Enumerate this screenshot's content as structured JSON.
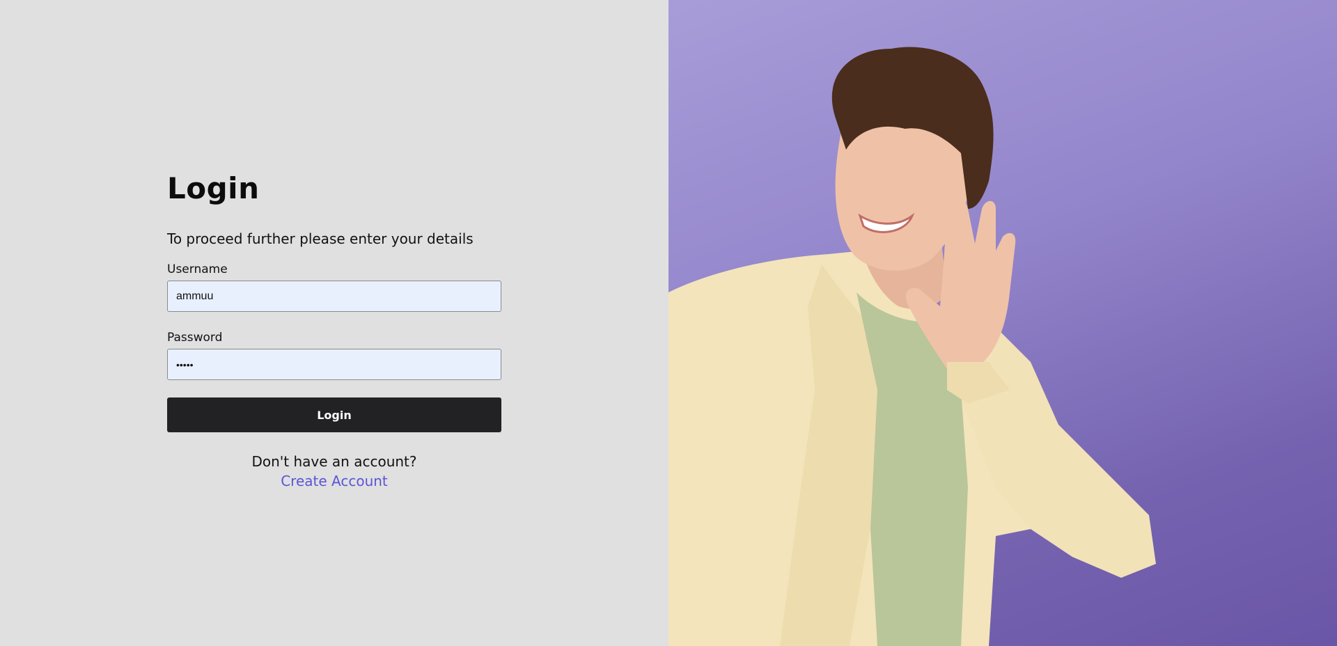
{
  "login": {
    "title": "Login",
    "subtitle": "To proceed further please enter your details",
    "username": {
      "label": "Username",
      "value": "ammuu"
    },
    "password": {
      "label": "Password",
      "value": "•••••"
    },
    "submit_label": "Login",
    "signup_prompt": "Don't have an account?",
    "signup_link": "Create Account"
  },
  "colors": {
    "left_background": "#e0e0e0",
    "input_background": "#e8f0fe",
    "button_background": "#222224",
    "link_color": "#5b55d6",
    "photo_background": "#9385cb"
  },
  "hero_image": {
    "subject": "smiling man waving"
  }
}
